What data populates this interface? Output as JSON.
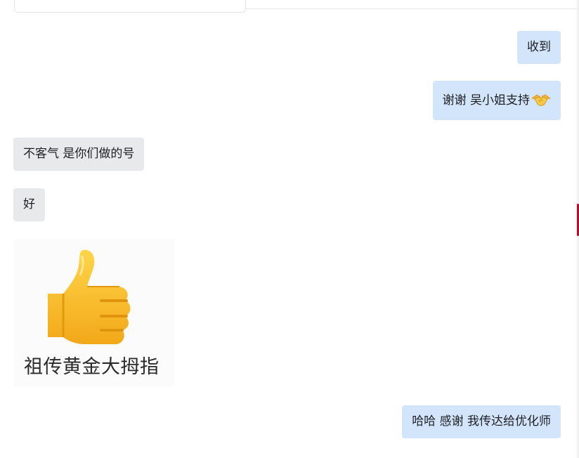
{
  "conversation": {
    "messages": [
      {
        "direction": "outgoing",
        "text": "收到"
      },
      {
        "direction": "outgoing",
        "text": "谢谢 吴小姐支持",
        "emoji": "handshake-icon"
      },
      {
        "direction": "incoming",
        "text": "不客气 是你们做的号"
      },
      {
        "direction": "incoming",
        "text": "好"
      },
      {
        "direction": "incoming",
        "type": "sticker",
        "sticker_icon": "thumbs-up-icon",
        "caption": "祖传黄金大拇指"
      },
      {
        "direction": "outgoing",
        "text": "哈哈 感谢 我传达给优化师"
      }
    ]
  },
  "colors": {
    "outgoing_bubble": "#d3e5fb",
    "incoming_bubble": "#e8e9eb",
    "background": "#ffffff",
    "text": "#1d1f23"
  }
}
